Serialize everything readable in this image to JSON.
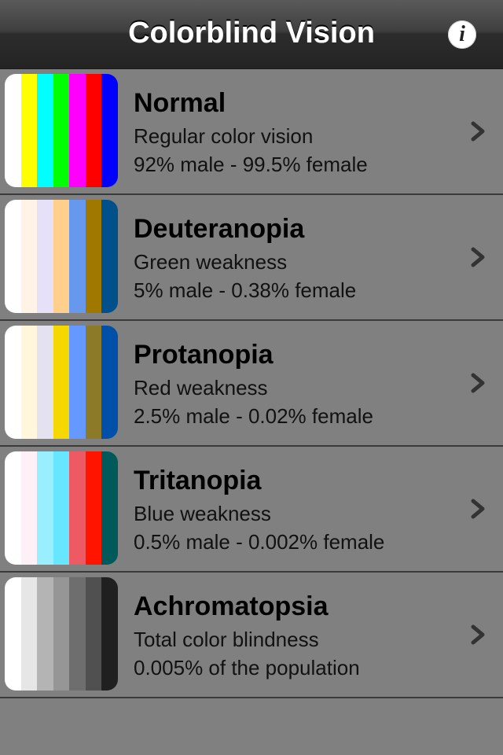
{
  "navbar": {
    "title": "Colorblind Vision",
    "info_icon": "info-icon",
    "info_glyph": "i"
  },
  "rows": [
    {
      "title": "Normal",
      "subtitle": "Regular color vision",
      "stat": "92% male - 99.5% female",
      "colors": [
        "#ffffff",
        "#ffff00",
        "#00ffff",
        "#00ff00",
        "#ff00ff",
        "#ff0000",
        "#0000ff"
      ]
    },
    {
      "title": "Deuteranopia",
      "subtitle": "Green weakness",
      "stat": "5% male - 0.38% female",
      "colors": [
        "#ffffff",
        "#fff2e6",
        "#e6e0f8",
        "#ffd08c",
        "#6699ee",
        "#a07800",
        "#00508c"
      ]
    },
    {
      "title": "Protanopia",
      "subtitle": "Red weakness",
      "stat": "2.5% male - 0.02% female",
      "colors": [
        "#ffffff",
        "#fff6dc",
        "#e4e2f0",
        "#f5d800",
        "#6699ff",
        "#8c7a28",
        "#0050aa"
      ]
    },
    {
      "title": "Tritanopia",
      "subtitle": "Blue weakness",
      "stat": "0.5% male - 0.002% female",
      "colors": [
        "#ffffff",
        "#fff0f8",
        "#99eeff",
        "#66e6ff",
        "#ee5a64",
        "#ff1400",
        "#005a5a"
      ]
    },
    {
      "title": "Achromatopsia",
      "subtitle": "Total color blindness",
      "stat": "0.005% of the population",
      "colors": [
        "#ffffff",
        "#e6e6e6",
        "#b4b4b4",
        "#969696",
        "#6e6e6e",
        "#505050",
        "#202020"
      ]
    }
  ]
}
